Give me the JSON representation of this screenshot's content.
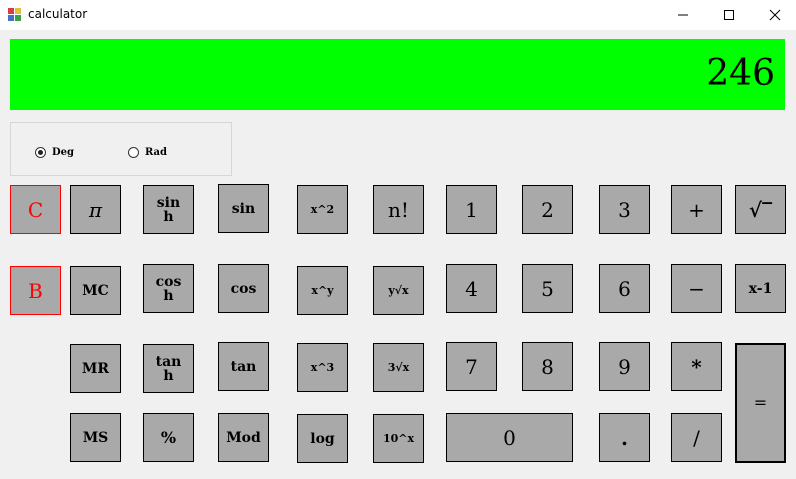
{
  "window": {
    "title": "calculator",
    "icon": "app-icon",
    "controls": [
      "minimize-icon",
      "maximize-icon",
      "close-icon"
    ]
  },
  "display": {
    "value": "246",
    "background": "#00ff00"
  },
  "mode": {
    "options": [
      {
        "label": "Deg",
        "selected": true
      },
      {
        "label": "Rad",
        "selected": false
      }
    ]
  },
  "buttons": {
    "clear": "C",
    "back": "B",
    "pi": "π",
    "mc": "MC",
    "mr": "MR",
    "ms": "MS",
    "sinh": "sin\nh",
    "cosh": "cos\nh",
    "tanh": "tan\nh",
    "percent": "%",
    "sin": "sin",
    "cos": "cos",
    "tan": "tan",
    "mod": "Mod",
    "x_pow2": "x^2",
    "x_pow_y": "x^y",
    "x_pow3": "x^3",
    "log": "log",
    "factorial": "n!",
    "y_root_x": "y√x",
    "cube_root": "3√x",
    "ten_pow_x": "10^x",
    "d1": "1",
    "d2": "2",
    "d3": "3",
    "d4": "4",
    "d5": "5",
    "d6": "6",
    "d7": "7",
    "d8": "8",
    "d9": "9",
    "d0": "0",
    "dot": ".",
    "plus": "+",
    "minus": "−",
    "multiply": "*",
    "divide": "/",
    "sqrt": "√‾",
    "reciprocal": "x-1",
    "equals": "="
  },
  "colors": {
    "button_bg": "#a9a9a9",
    "accent_red": "#ff0000",
    "window_bg": "#f0f0f0"
  }
}
